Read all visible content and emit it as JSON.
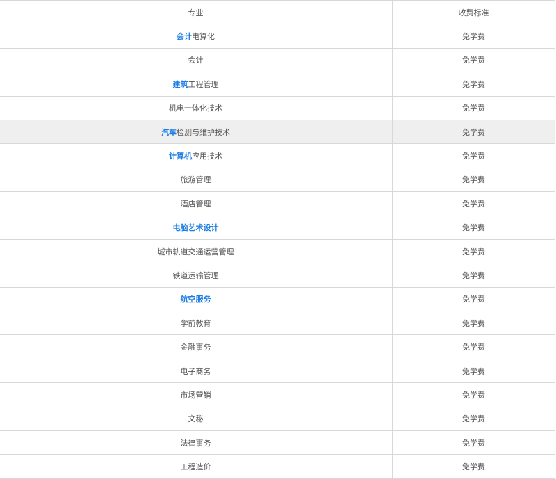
{
  "table": {
    "headers": {
      "major": "专业",
      "fee": "收费标准"
    },
    "rows": [
      {
        "link": "会计",
        "rest": "电算化",
        "fee": "免学费"
      },
      {
        "link": "",
        "rest": "会计",
        "fee": "免学费"
      },
      {
        "link": "建筑",
        "rest": "工程管理",
        "fee": "免学费"
      },
      {
        "link": "",
        "rest": "机电一体化技术",
        "fee": "免学费"
      },
      {
        "link": "汽车",
        "rest": "检测与维护技术",
        "fee": "免学费"
      },
      {
        "link": "计算机",
        "rest": "应用技术",
        "fee": "免学费"
      },
      {
        "link": "",
        "rest": "旅游管理",
        "fee": "免学费"
      },
      {
        "link": "",
        "rest": "酒店管理",
        "fee": "免学费"
      },
      {
        "link": "电脑艺术设计",
        "rest": "",
        "fee": "免学费"
      },
      {
        "link": "",
        "rest": "城市轨道交通运营管理",
        "fee": "免学费"
      },
      {
        "link": "",
        "rest": "铁道运输管理",
        "fee": "免学费"
      },
      {
        "link": "航空服务",
        "rest": "",
        "fee": "免学费"
      },
      {
        "link": "",
        "rest": "学前教育",
        "fee": "免学费"
      },
      {
        "link": "",
        "rest": "金融事务",
        "fee": "免学费"
      },
      {
        "link": "",
        "rest": "电子商务",
        "fee": "免学费"
      },
      {
        "link": "",
        "rest": "市场营销",
        "fee": "免学费"
      },
      {
        "link": "",
        "rest": "文秘",
        "fee": "免学费"
      },
      {
        "link": "",
        "rest": "法律事务",
        "fee": "免学费"
      },
      {
        "link": "",
        "rest": "工程造价",
        "fee": "免学费"
      }
    ]
  }
}
